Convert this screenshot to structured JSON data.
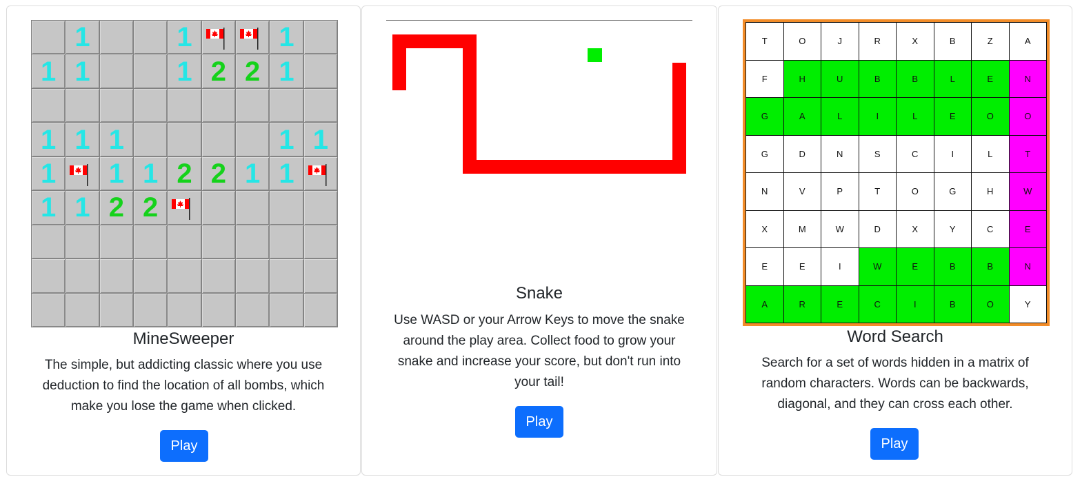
{
  "cards": [
    {
      "title": "MineSweeper",
      "description": "The simple, but addicting classic where you use deduction to find the location of all bombs, which make you lose the game when clicked.",
      "play_label": "Play"
    },
    {
      "title": "Snake",
      "description": "Use WASD or your Arrow Keys to move the snake around the play area. Collect food to grow your snake and increase your score, but don't run into your tail!",
      "play_label": "Play"
    },
    {
      "title": "Word Search",
      "description": "Search for a set of words hidden in a matrix of random characters. Words can be backwards, diagonal, and they can cross each other.",
      "play_label": "Play"
    }
  ],
  "minesweeper": {
    "rows": [
      [
        "",
        "1",
        "",
        "",
        "1",
        "F",
        "F",
        "1",
        ""
      ],
      [
        "1",
        "1",
        "",
        "",
        "1",
        "2",
        "2",
        "1",
        ""
      ],
      [
        "",
        "",
        "",
        "",
        "",
        "",
        "",
        "",
        ""
      ],
      [
        "1",
        "1",
        "1",
        "",
        "",
        "",
        "",
        "1",
        "1"
      ],
      [
        "1",
        "F",
        "1",
        "1",
        "2",
        "2",
        "1",
        "1",
        "F"
      ],
      [
        "1",
        "1",
        "2",
        "2",
        "F",
        "",
        "",
        "",
        ""
      ],
      [
        "",
        "",
        "",
        "",
        "",
        "",
        "",
        "",
        ""
      ],
      [
        "",
        "",
        "",
        "",
        "",
        "",
        "",
        "",
        ""
      ],
      [
        "",
        "",
        "",
        "",
        "",
        "",
        "",
        "",
        ""
      ]
    ],
    "colors": {
      "one": "#25e6e6",
      "two": "#15d21b",
      "flag_red": "#ff0000"
    }
  },
  "snake": {
    "colors": {
      "snake": "#ff0000",
      "food": "#00ee00"
    }
  },
  "word_search": {
    "grid": [
      [
        "T",
        "O",
        "J",
        "R",
        "X",
        "B",
        "Z",
        "A"
      ],
      [
        "F",
        "H",
        "U",
        "B",
        "B",
        "L",
        "E",
        "N"
      ],
      [
        "G",
        "A",
        "L",
        "I",
        "L",
        "E",
        "O",
        "O"
      ],
      [
        "G",
        "D",
        "N",
        "S",
        "C",
        "I",
        "L",
        "T"
      ],
      [
        "N",
        "V",
        "P",
        "T",
        "O",
        "G",
        "H",
        "W"
      ],
      [
        "X",
        "M",
        "W",
        "D",
        "X",
        "Y",
        "C",
        "E"
      ],
      [
        "E",
        "E",
        "I",
        "W",
        "E",
        "B",
        "B",
        "N"
      ],
      [
        "A",
        "R",
        "E",
        "C",
        "I",
        "B",
        "O",
        "Y"
      ]
    ],
    "highlights": [
      [
        "",
        "",
        "",
        "",
        "",
        "",
        "",
        ""
      ],
      [
        "",
        "g",
        "g",
        "g",
        "g",
        "g",
        "g",
        "m"
      ],
      [
        "g",
        "g",
        "g",
        "g",
        "g",
        "g",
        "g",
        "m"
      ],
      [
        "",
        "",
        "",
        "",
        "",
        "",
        "",
        "m"
      ],
      [
        "",
        "",
        "",
        "",
        "",
        "",
        "",
        "m"
      ],
      [
        "",
        "",
        "",
        "",
        "",
        "",
        "",
        "m"
      ],
      [
        "",
        "",
        "",
        "g",
        "g",
        "g",
        "g",
        "m"
      ],
      [
        "g",
        "g",
        "g",
        "g",
        "g",
        "g",
        "g",
        ""
      ]
    ],
    "colors": {
      "found": "#00ee00",
      "selected": "#ff00ff",
      "border": "#f28c28"
    }
  }
}
